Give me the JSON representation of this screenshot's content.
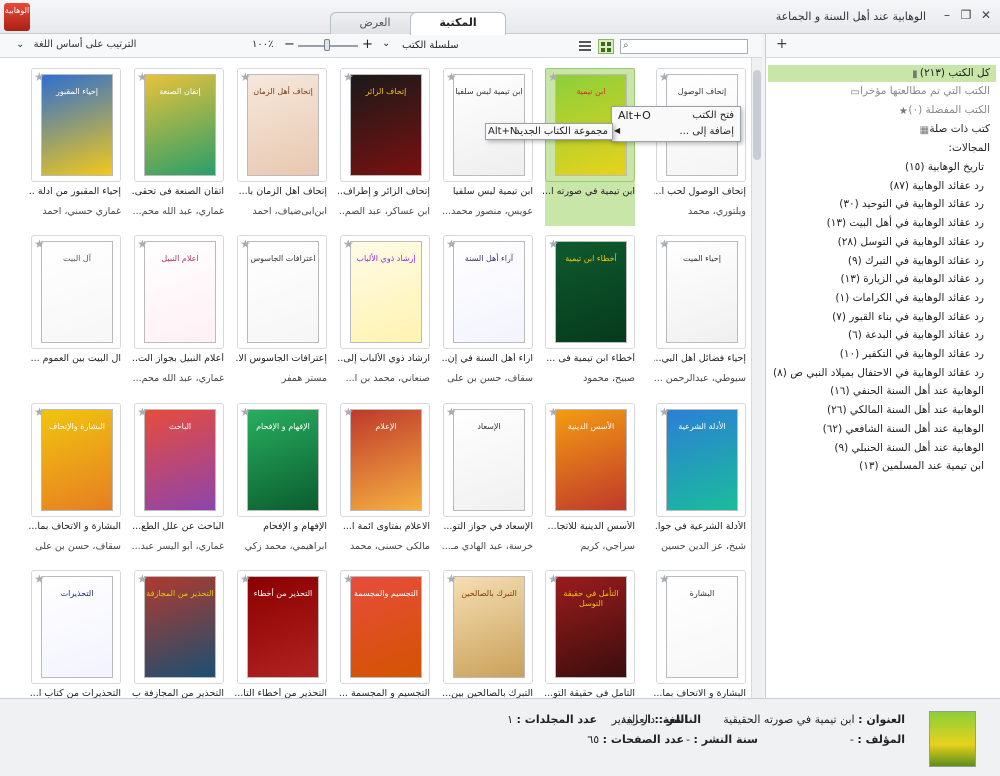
{
  "window": {
    "title": "الوهابية عند أهل السنة و الجماعة",
    "logo_text": "الوهابية",
    "tabs": {
      "library": "المكتبة",
      "view": "العرض"
    }
  },
  "toolbar": {
    "sort_label": "الترتيب على أساس اللغة",
    "zoom_value": "١٠٠٪",
    "series_label": "سلسلة الكتب",
    "search_placeholder": ""
  },
  "context_menu": {
    "open": "فتح الكتب",
    "open_shortcut": "Alt+O",
    "add_to": "إضافة إلى ...",
    "sub_item": "مجموعة الكتاب الجديد",
    "sub_shortcut": "Alt+N"
  },
  "books": [
    {
      "title": "إتحاف الوصول لحب ا...",
      "author": "ويلتوري، محمد",
      "cover_text": "إتحاف الوصول",
      "c1": "#ffffff",
      "c2": "#f4f4f4",
      "fg": "#333333"
    },
    {
      "title": "ابن تيمية في صورته ا...",
      "author": "",
      "cover_text": "ابن تيمية",
      "c1": "#8ccf3a",
      "c2": "#e7d21c",
      "fg": "#c0392b",
      "selected": true
    },
    {
      "title": "ابن تيمية ليس سلفيا",
      "author": "عويس، منصور محمد...",
      "cover_text": "ابن تيمية ليس سلفيا",
      "c1": "#ffffff",
      "c2": "#eeeeee",
      "fg": "#333333"
    },
    {
      "title": "إتحاف الزائر و إطراف...",
      "author": "ابن عساكر، عبد الصم...",
      "cover_text": "إتحاف الزائر",
      "c1": "#1a1a1a",
      "c2": "#7a1010",
      "fg": "#f1c40f"
    },
    {
      "title": "إتحاف أهل الزمان بأ...",
      "author": "ابن‌ابی‌ضیاف، احمد",
      "cover_text": "إتحاف أهل الزمان",
      "c1": "#f5e8dc",
      "c2": "#e8c8b0",
      "fg": "#7a3b1a"
    },
    {
      "title": "اتقان الصنعة فی تحقی...",
      "author": "غماري، عبد الله محم...",
      "cover_text": "إتقان الصنعة",
      "c1": "#e8c23a",
      "c2": "#2a9e6a",
      "fg": "#ffffff"
    },
    {
      "title": "إحياء المقبور من ادلة ...",
      "author": "غماري حسني، احمد",
      "cover_text": "إحياء المقبور",
      "c1": "#2f6fd0",
      "c2": "#f2c81b",
      "fg": "#ffffff"
    },
    {
      "title": "إحياء فضائل أهل البي...",
      "author": "سيوطي، عبدالرحمن ...",
      "cover_text": "إحياء الميت",
      "c1": "#ffffff",
      "c2": "#f0f0f0",
      "fg": "#333333"
    },
    {
      "title": "أخطاء ابن تيمية فی ...",
      "author": "صبيح، محمود",
      "cover_text": "أخطاء ابن تيمية",
      "c1": "#0f5a2e",
      "c2": "#063a1c",
      "fg": "#f1c40f"
    },
    {
      "title": "آراء أهل السنة في إن...",
      "author": "سقاف، حسن بن علی",
      "cover_text": "آراء أهل السنة",
      "c1": "#ffffff",
      "c2": "#f3f3ff",
      "fg": "#333366"
    },
    {
      "title": "ارشاد ذوي الألباب إلى...",
      "author": "صنعاني، محمد بن ا...",
      "cover_text": "إرشاد ذوي الألباب",
      "c1": "#fffbe6",
      "c2": "#fff3b0",
      "fg": "#8a2be2"
    },
    {
      "title": "إعترافات الجاسوس الا...",
      "author": "مستر همفر",
      "cover_text": "اعترافات الجاسوس",
      "c1": "#ffffff",
      "c2": "#f6f6f6",
      "fg": "#333333"
    },
    {
      "title": "أعلام النبيل بجواز الت...",
      "author": "غماري، عبد الله محم...",
      "cover_text": "اعلام النبيل",
      "c1": "#ffffff",
      "c2": "#fff0f5",
      "fg": "#b03060"
    },
    {
      "title": "آل البيت بين العموم ...",
      "author": "",
      "cover_text": "آل البيت",
      "c1": "#ffffff",
      "c2": "#f7f7f7",
      "fg": "#555555"
    },
    {
      "title": "الأدلة الشرعية في جوا...",
      "author": "شيخ، عز الدين حسين",
      "cover_text": "الأدلة الشرعية",
      "c1": "#2c7fd6",
      "c2": "#1abc9c",
      "fg": "#ffffff"
    },
    {
      "title": "الأسس الدينية للاتجا...",
      "author": "سراجي، كريم",
      "cover_text": "الأسس الدينية",
      "c1": "#f39c12",
      "c2": "#c0392b",
      "fg": "#ffffff"
    },
    {
      "title": "الإسعاد في جواز التو...",
      "author": "خرسة، عبد الهادي مـ...",
      "cover_text": "الإسعاد",
      "c1": "#ffffff",
      "c2": "#f0f0f0",
      "fg": "#333333"
    },
    {
      "title": "الاعلام بفتاوى ائمة ا...",
      "author": "مالکی حسنی، محمد",
      "cover_text": "الإعلام",
      "c1": "#c0392b",
      "c2": "#f5b041",
      "fg": "#ffffff"
    },
    {
      "title": "الإفهام و الإفحام",
      "author": "ابراهيمي، محمد زكي",
      "cover_text": "الإفهام و الإفحام",
      "c1": "#27ae60",
      "c2": "#0b5d2e",
      "fg": "#ffffff"
    },
    {
      "title": "الباحث عن علل الطع...",
      "author": "غماري، أبو اليسر عبد...",
      "cover_text": "الباحث",
      "c1": "#e74c3c",
      "c2": "#8e44ad",
      "fg": "#ffffff"
    },
    {
      "title": "البشارة و الاتحاف بما...",
      "author": "سقاف، حسن بن علی",
      "cover_text": "البشارة والإتحاف",
      "c1": "#f1c40f",
      "c2": "#e67e22",
      "fg": "#ffffff"
    },
    {
      "title": "البشارة و الاتحاف بما...",
      "author": "",
      "cover_text": "البشارة",
      "c1": "#ffffff",
      "c2": "#f7f7f7",
      "fg": "#333333"
    },
    {
      "title": "التأمل فی حقيقة التو...",
      "author": "",
      "cover_text": "التأمل في حقيقة التوسل",
      "c1": "#9b1c1c",
      "c2": "#3b0d0d",
      "fg": "#f1c40f"
    },
    {
      "title": "التبرك بالصالحين بين...",
      "author": "",
      "cover_text": "التبرك بالصالحين",
      "c1": "#f5deb3",
      "c2": "#c9a15a",
      "fg": "#7b3f00"
    },
    {
      "title": "التجسيم و المجسمة ...",
      "author": "",
      "cover_text": "التجسيم والمجسمة",
      "c1": "#e74c3c",
      "c2": "#d35400",
      "fg": "#ffffff"
    },
    {
      "title": "التحذير من أخطاء التا...",
      "author": "",
      "cover_text": "التحذير من أخطاء",
      "c1": "#8b0000",
      "c2": "#b22222",
      "fg": "#ffffff"
    },
    {
      "title": "التحذير من المجازفة ب...",
      "author": "",
      "cover_text": "التحذير من المجازفة",
      "c1": "#b03a2e",
      "c2": "#1b4f72",
      "fg": "#f1c40f"
    },
    {
      "title": "التحذيرات من كتاب ا...",
      "author": "",
      "cover_text": "التحذيرات",
      "c1": "#ffffff",
      "c2": "#f3f3ff",
      "fg": "#1a237e"
    }
  ],
  "sidebar": {
    "all_books": "كل الكتب (٢١٣)",
    "recent": "الكتب التي تم مطالعتها مؤخرا",
    "favorites": "الكتب المفضلة (٠)",
    "related": "كتب ذات صلة",
    "collections_label": "المجالات:",
    "categories": [
      "تاريخ الوهابية (١٥)",
      "رد عقائد الوهابية (٨٧)",
      "رد عقائد الوهابية في التوحيد (٣٠)",
      "رد عقائد الوهابية في أهل البيت (١٣)",
      "رد عقائد الوهابية في التوسل (٢٨)",
      "رد عقائد الوهابية في التبرك (٩)",
      "رد عقائد الوهابية في الزيارة (١٣)",
      "رد عقائد الوهابية في الكرامات (١)",
      "رد عقائد الوهابية في بناء القبور (٧)",
      "رد عقائد الوهابية في البدعة (٦)",
      "رد عقائد الوهابية في التكفير (١٠)",
      "رد عقائد الوهابية في الاحتفال بميلاد النبي ص (٨)",
      "الوهابية عند أهل السنة الحنفي (١٦)",
      "الوهابية عند أهل السنة المالكي (٢٦)",
      "الوهابية عند أهل السنة الشافعي (٦٢)",
      "الوهابية عند أهل السنة الحنبلي (٩)",
      "ابن تيمية عند المسلمين (١٣)"
    ]
  },
  "details": {
    "title_label": "العنوان :",
    "title_value": "ابن تيمية في صورته الحقيقية",
    "publisher_label": "الناشر :",
    "publisher_value": "دار الغدير",
    "language_label": "اللغة :",
    "language_value": "العربية",
    "volumes_label": "عدد المجلدات :",
    "volumes_value": "١",
    "author_label": "المؤلف :",
    "author_value": "-",
    "year_label": "سنة النشر :",
    "year_value": "-",
    "pages_label": "عدد الصفحات :",
    "pages_value": "٦٥"
  }
}
